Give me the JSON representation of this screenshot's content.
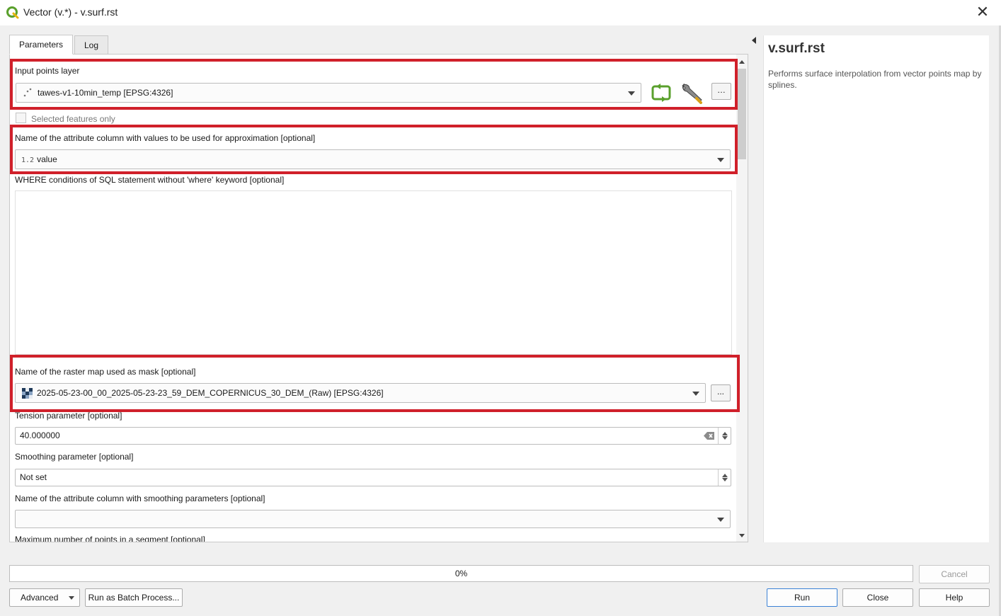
{
  "window": {
    "title": "Vector (v.*) - v.surf.rst",
    "close_glyph": "✕"
  },
  "tabs": [
    {
      "label": "Parameters",
      "active": true
    },
    {
      "label": "Log",
      "active": false
    }
  ],
  "params": {
    "input_layer": {
      "label": "Input points layer",
      "value": "tawes-v1-10min_temp [EPSG:4326]",
      "icon": "point-layer-icon"
    },
    "selected_only": {
      "label": "Selected features only",
      "checked": false
    },
    "zcolumn": {
      "label": "Name of the attribute column with values to be used for approximation [optional]",
      "type_badge": "1.2",
      "value": "value"
    },
    "where": {
      "label": "WHERE conditions of SQL statement without 'where' keyword [optional]",
      "value": ""
    },
    "mask": {
      "label": "Name of the raster map used as mask [optional]",
      "value": "2025-05-23-00_00_2025-05-23-23_59_DEM_COPERNICUS_30_DEM_(Raw) [EPSG:4326]",
      "icon": "raster-layer-icon"
    },
    "tension": {
      "label": "Tension parameter [optional]",
      "value": "40.000000"
    },
    "smooth": {
      "label": "Smoothing parameter [optional]",
      "value": "Not set"
    },
    "smooth_column": {
      "label": "Name of the attribute column with smoothing parameters [optional]",
      "value": ""
    },
    "segmax": {
      "label": "Maximum number of points in a segment [optional]"
    }
  },
  "toolbar_buttons": {
    "browse": "...",
    "browse_dd": "…"
  },
  "help": {
    "title": "v.surf.rst",
    "description": "Performs surface interpolation from vector points map by splines."
  },
  "progress": {
    "text": "0%",
    "value": 0
  },
  "buttons": {
    "advanced": "Advanced",
    "batch": "Run as Batch Process...",
    "run": "Run",
    "close": "Close",
    "help": "Help",
    "cancel": "Cancel"
  },
  "colors": {
    "highlight": "#d0202a",
    "accent": "#3c82d6",
    "qgis_green": "#5aa02c"
  }
}
